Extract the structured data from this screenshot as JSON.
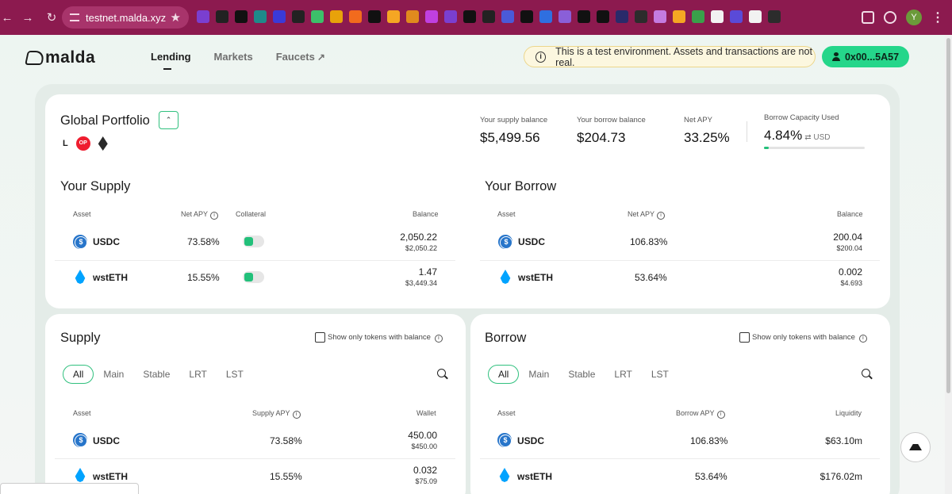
{
  "browser": {
    "url": "testnet.malda.xyz",
    "nav_back": "←",
    "nav_forward": "→",
    "nav_reload": "↻",
    "star": "★",
    "avatar_letter": "Y",
    "menu": "⋮",
    "extension_colors": [
      "#7a3fd0",
      "#222222",
      "#111111",
      "#1e8a8a",
      "#3a3ad8",
      "#222222",
      "#3cc06a",
      "#e8a20a",
      "#f26b1d",
      "#111111",
      "#f5a623",
      "#e08a1e",
      "#c040e0",
      "#7a3fd0",
      "#111111",
      "#222222",
      "#4a5ad8",
      "#111111",
      "#2f6fe0",
      "#8a5fd8",
      "#111111",
      "#111111",
      "#2a2a6a",
      "#2c2c2c",
      "#c47be0",
      "#f5a623",
      "#3aa04a",
      "#f2f2f2",
      "#5a4ad8",
      "#f2f2f2",
      "#2c2c2c"
    ]
  },
  "header": {
    "logo": "malda",
    "nav": [
      "Lending",
      "Markets",
      "Faucets"
    ],
    "external_link_icon": "↗",
    "banner": "This is a test environment. Assets and transactions are not real.",
    "wallet": "0x00...5A57"
  },
  "portfolio": {
    "title": "Global Portfolio",
    "collapse_icon": "⌃",
    "chains": [
      "L",
      "OP",
      "ETH"
    ],
    "stats": {
      "supply_label": "Your supply balance",
      "supply_value": "$5,499.56",
      "borrow_label": "Your borrow balance",
      "borrow_value": "$204.73",
      "apy_label": "Net APY",
      "apy_value": "33.25%",
      "capacity_label": "Borrow Capacity Used",
      "capacity_value": "4.84%",
      "capacity_unit": "⇄ USD",
      "capacity_fraction": 0.0484
    },
    "your_supply": {
      "title": "Your Supply",
      "headers": [
        "Asset",
        "Net APY",
        "Collateral",
        "Balance"
      ],
      "rows": [
        {
          "asset": "USDC",
          "apy": "73.58%",
          "balance": "2,050.22",
          "balance_usd": "$2,050.22",
          "collateral": true
        },
        {
          "asset": "wstETH",
          "apy": "15.55%",
          "balance": "1.47",
          "balance_usd": "$3,449.34",
          "collateral": true
        }
      ]
    },
    "your_borrow": {
      "title": "Your Borrow",
      "headers": [
        "Asset",
        "Net APY",
        "Balance"
      ],
      "rows": [
        {
          "asset": "USDC",
          "apy": "106.83%",
          "balance": "200.04",
          "balance_usd": "$200.04"
        },
        {
          "asset": "wstETH",
          "apy": "53.64%",
          "balance": "0.002",
          "balance_usd": "$4.693"
        }
      ]
    }
  },
  "supply_market": {
    "title": "Supply",
    "filter_label": "Show only tokens with balance",
    "tabs": [
      "All",
      "Main",
      "Stable",
      "LRT",
      "LST"
    ],
    "headers": [
      "Asset",
      "Supply APY",
      "Wallet"
    ],
    "rows": [
      {
        "asset": "USDC",
        "apy": "73.58%",
        "wallet": "450.00",
        "wallet_usd": "$450.00"
      },
      {
        "asset": "wstETH",
        "apy": "15.55%",
        "wallet": "0.032",
        "wallet_usd": "$75.09"
      }
    ]
  },
  "borrow_market": {
    "title": "Borrow",
    "filter_label": "Show only tokens with balance",
    "tabs": [
      "All",
      "Main",
      "Stable",
      "LRT",
      "LST"
    ],
    "headers": [
      "Asset",
      "Borrow APY",
      "Liquidity"
    ],
    "rows": [
      {
        "asset": "USDC",
        "apy": "106.83%",
        "liquidity": "$63.10m"
      },
      {
        "asset": "wstETH",
        "apy": "53.64%",
        "liquidity": "$176.02m"
      }
    ]
  },
  "colors": {
    "chrome": "#8c1a4f",
    "accent_green": "#25d68a",
    "banner_bg": "#fcf7df",
    "usdc": "#2775ca",
    "wsteth": "#00a3ff"
  }
}
